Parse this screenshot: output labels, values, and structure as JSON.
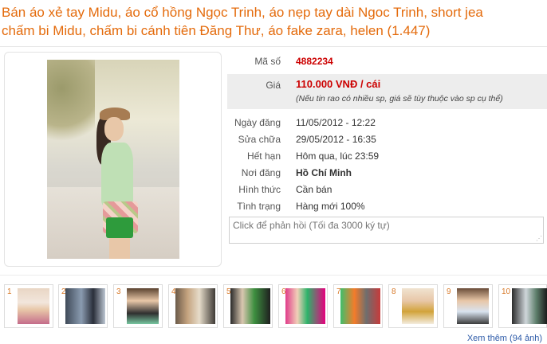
{
  "listing": {
    "title_line1": "Bán áo xẻ tay Midu, áo cổ hồng Ngọc Trinh, áo nẹp tay dài Ngoc Trinh, short jea",
    "title_line2": "chấm bi Midu, chấm bi cánh tiên Đăng Thư, áo fake zara, helen (1.447)"
  },
  "details": {
    "ma_so_label": "Mã số",
    "ma_so": "4882234",
    "gia_label": "Giá",
    "gia": "110.000 VNĐ / cái",
    "gia_note": "(Nếu tin rao có nhiều sp, giá sẽ tùy thuộc vào sp cụ thể)",
    "rows": [
      {
        "label": "Ngày đăng",
        "value": "11/05/2012 - 12:22"
      },
      {
        "label": "Sửa chữa",
        "value": "29/05/2012 - 16:35"
      },
      {
        "label": "Hết hạn",
        "value": "Hôm qua, lúc 23:59"
      },
      {
        "label": "Nơi đăng",
        "value": "Hồ Chí Minh"
      },
      {
        "label": "Hình thức",
        "value": "Cần bán"
      },
      {
        "label": "Tình trạng",
        "value": "Hàng mới 100%"
      }
    ]
  },
  "reply": {
    "placeholder": "Click để phản hồi (Tối đa 3000 ký tự)"
  },
  "thumbnails": {
    "numbers": [
      "1",
      "2",
      "3",
      "4",
      "5",
      "6",
      "7",
      "8",
      "9",
      "10"
    ],
    "more_link": "Xem thêm (94 ảnh)"
  },
  "colors": {
    "title": "#e46b0c",
    "price": "#cc0000",
    "link": "#2c5aa8"
  }
}
